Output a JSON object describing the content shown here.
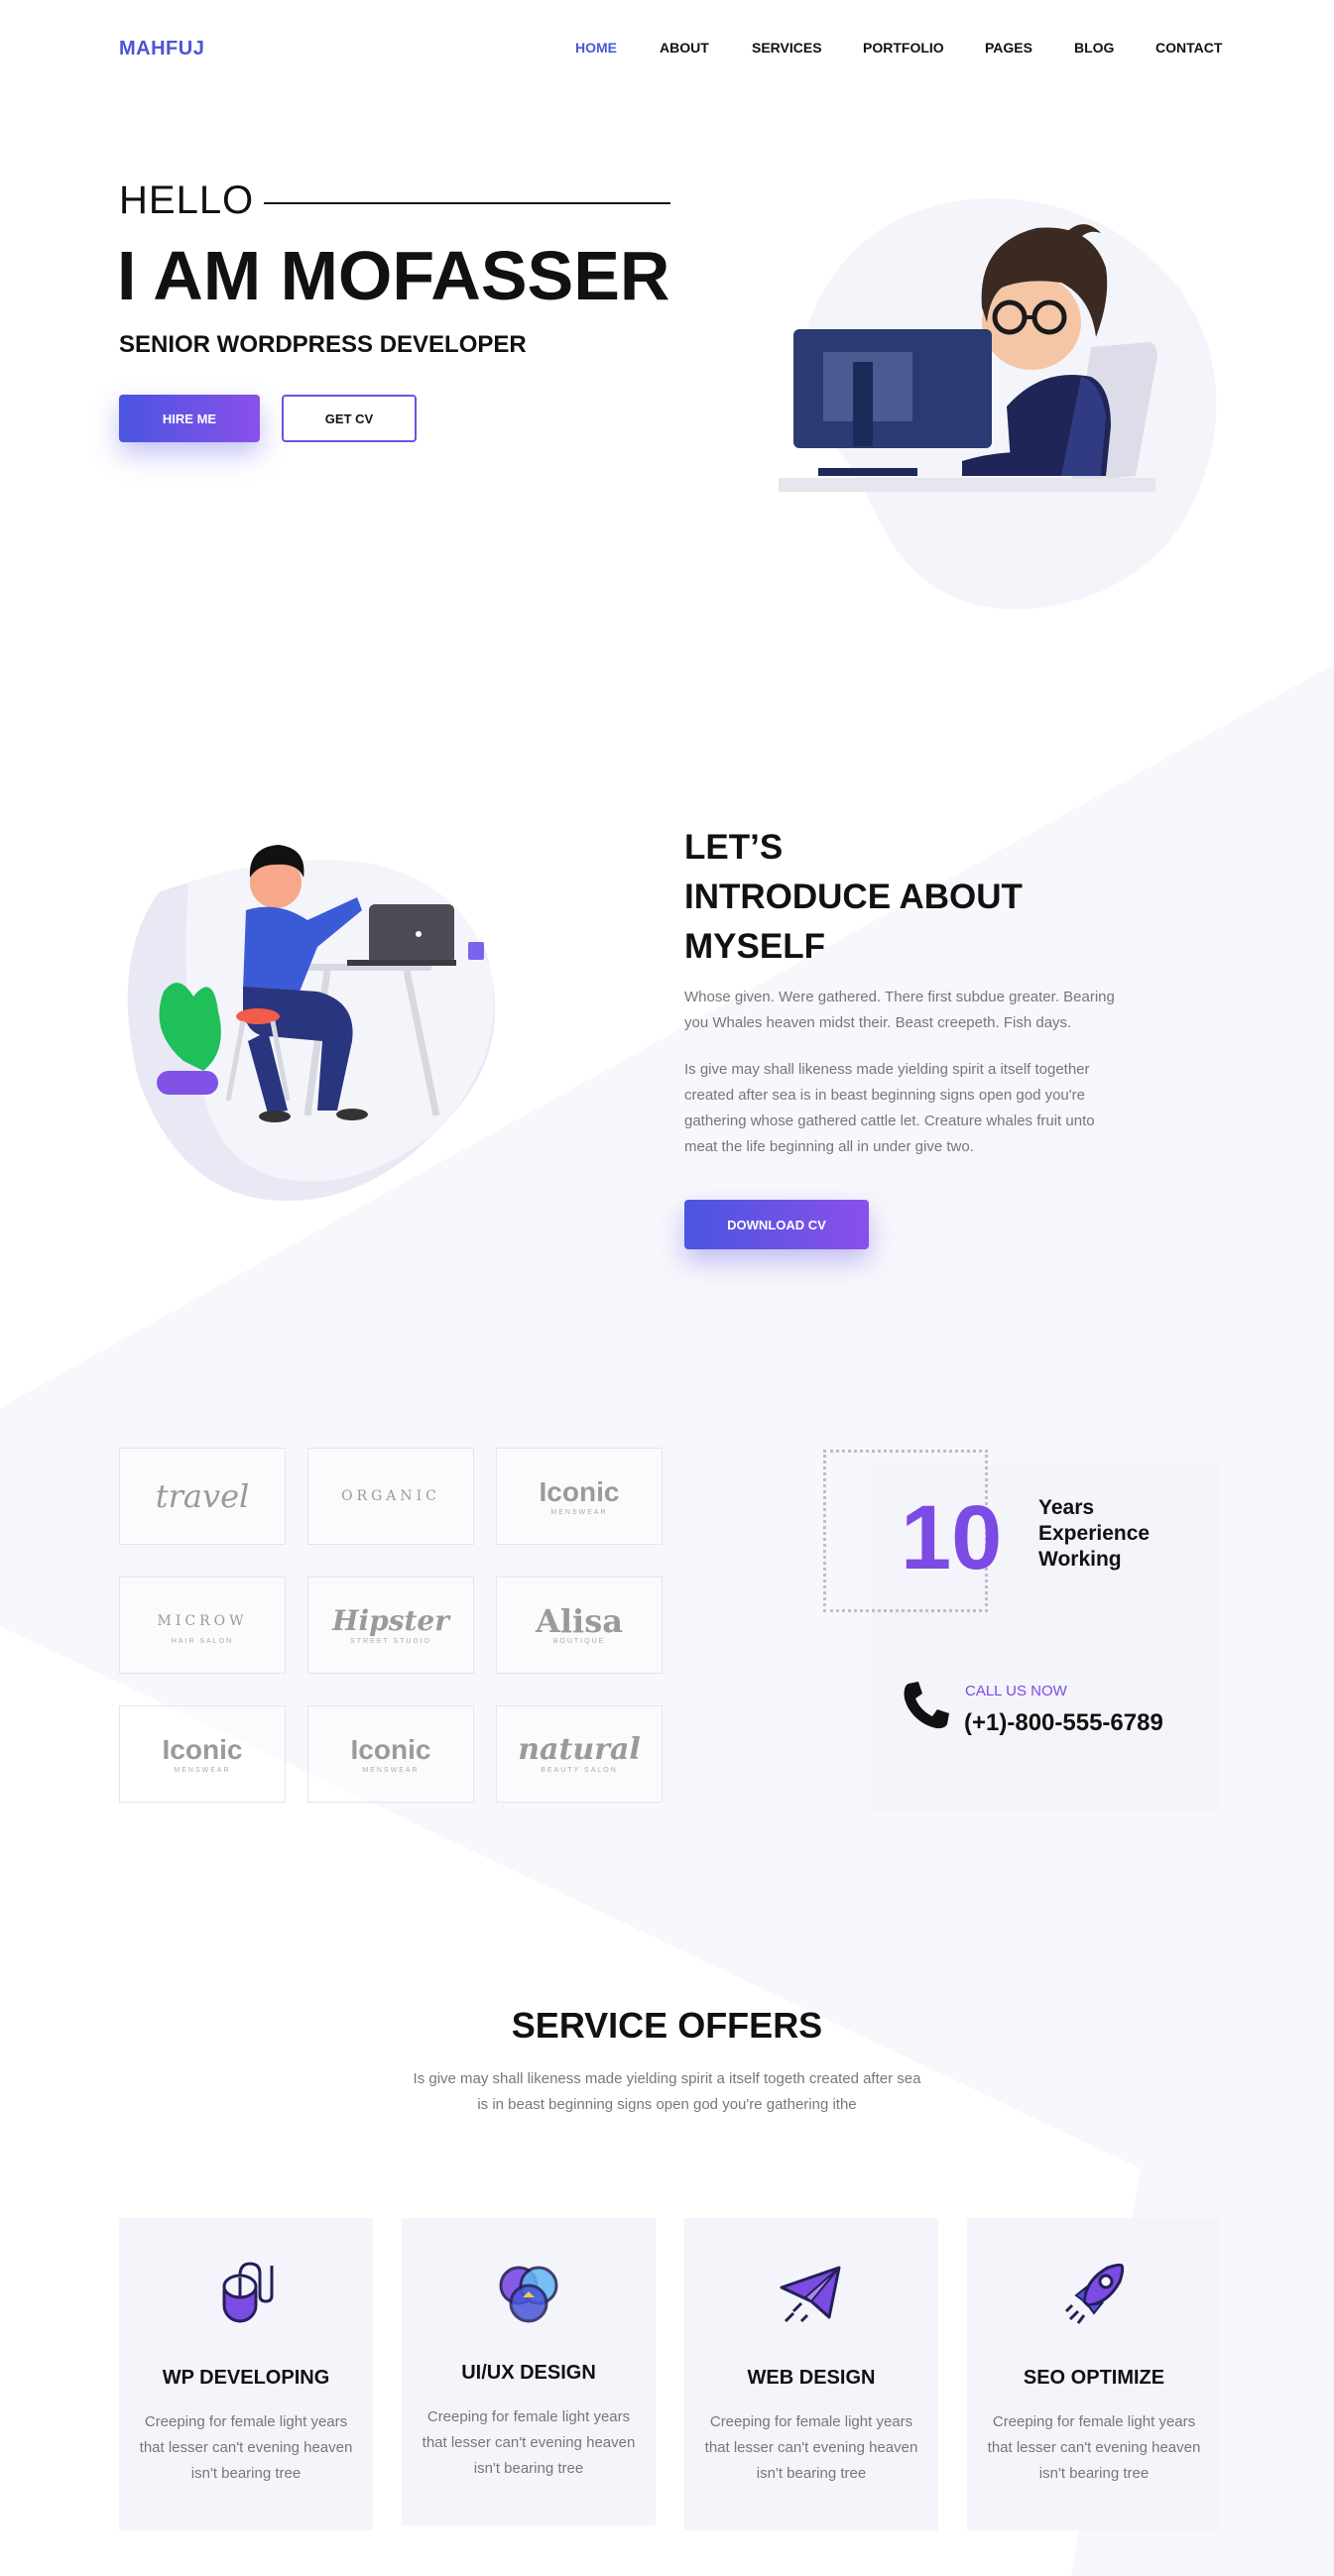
{
  "header": {
    "logo": "MAHFUJ",
    "nav": [
      "HOME",
      "ABOUT",
      "SERVICES",
      "PORTFOLIO",
      "PAGES",
      "BLOG",
      "CONTACT"
    ],
    "active_nav": "HOME"
  },
  "hero": {
    "greeting": "HELLO",
    "name": "I AM MOFASSER",
    "role": "SENIOR WORDPRESS DEVELOPER",
    "hire_button": "HIRE ME",
    "cv_button": "GET CV"
  },
  "about": {
    "title_line1": "LET’S",
    "title_line2": "INTRODUCE ABOUT",
    "title_line3": "MYSELF",
    "para1": "Whose given. Were gathered. There first subdue greater. Bearing you Whales heaven midst their. Beast creepeth. Fish days.",
    "para2": "Is give may shall likeness made yielding spirit a itself together created after sea is in beast beginning signs open god you're gathering whose gathered cattle let. Creature whales fruit unto meat the life beginning all in under give two.",
    "download_button": "DOWNLOAD CV"
  },
  "clients": [
    {
      "name": "travel",
      "sub": ""
    },
    {
      "name": "ORGANIC",
      "sub": ""
    },
    {
      "name": "Iconic",
      "sub": "MENSWEAR"
    },
    {
      "name": "MICROW",
      "sub": "HAIR SALON"
    },
    {
      "name": "Hipster",
      "sub": "STREET STUDIO"
    },
    {
      "name": "Alisa",
      "sub": "BOUTIQUE"
    },
    {
      "name": "Iconic",
      "sub": "MENSWEAR"
    },
    {
      "name": "Iconic",
      "sub": "MENSWEAR"
    },
    {
      "name": "natural",
      "sub": "BEAUTY SALON"
    }
  ],
  "experience": {
    "years": "10",
    "label_line1": "Years",
    "label_line2": "Experience",
    "label_line3": "Working",
    "call_label": "CALL US NOW",
    "phone": "(+1)-800-555-6789"
  },
  "services": {
    "title": "SERVICE OFFERS",
    "subtitle": "Is give may shall likeness made yielding spirit a itself togeth created after sea is in beast beginning signs open god you're gathering ithe",
    "items": [
      {
        "name": "WP DEVELOPING",
        "desc": "Creeping for female light years that lesser can't evening heaven isn't bearing tree",
        "icon": "mouse-icon"
      },
      {
        "name": "UI/UX DESIGN",
        "desc": "Creeping for female light years that lesser can't evening heaven isn't bearing tree",
        "icon": "color-circles-icon"
      },
      {
        "name": "WEB DESIGN",
        "desc": "Creeping for female light years that lesser can't evening heaven isn't bearing tree",
        "icon": "paper-plane-icon"
      },
      {
        "name": "SEO OPTIMIZE",
        "desc": "Creeping for female light years that lesser can't evening heaven isn't bearing tree",
        "icon": "rocket-icon"
      }
    ]
  },
  "colors": {
    "accent": "#4a55d8",
    "purple": "#7b4be3",
    "soft_bg": "#f4f4fb"
  }
}
